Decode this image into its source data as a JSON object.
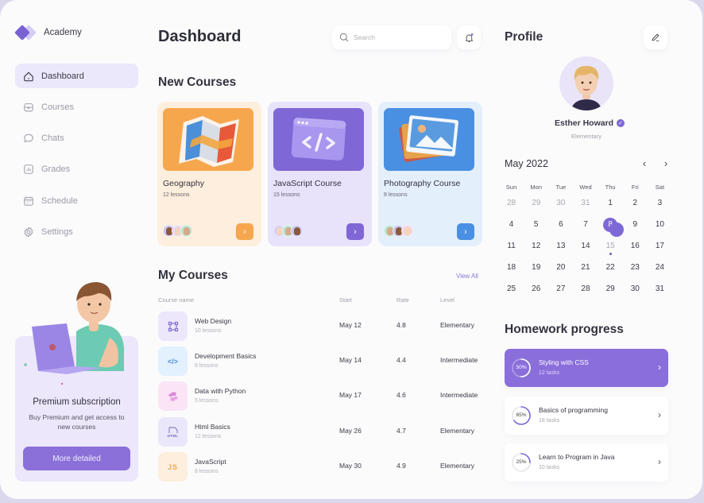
{
  "app": {
    "name": "Academy",
    "brand_color": "#7a62d4"
  },
  "sidebar": {
    "items": [
      {
        "label": "Dashboard",
        "icon": "home-icon",
        "active": true
      },
      {
        "label": "Courses",
        "icon": "briefcase-icon",
        "active": false
      },
      {
        "label": "Chats",
        "icon": "chat-bubble-icon",
        "active": false
      },
      {
        "label": "Grades",
        "icon": "bar-chart-icon",
        "active": false
      },
      {
        "label": "Schedule",
        "icon": "calendar-icon",
        "active": false
      },
      {
        "label": "Settings",
        "icon": "gear-icon",
        "active": false
      }
    ],
    "promo": {
      "title": "Premium subscription",
      "description": "Buy Premium and get access to new courses",
      "button_label": "More detailed"
    }
  },
  "header": {
    "title": "Dashboard",
    "search": {
      "placeholder": "Search",
      "value": ""
    },
    "notifications_icon": "bell-icon"
  },
  "new_courses": {
    "title": "New Courses",
    "cards": [
      {
        "title": "Geography",
        "lessons": "12 lessons",
        "theme": "orange",
        "accent": "#f6a74e"
      },
      {
        "title": "JavaScript Course",
        "lessons": "15 lessons",
        "theme": "purple",
        "accent": "#7f67d6"
      },
      {
        "title": "Photography Course",
        "lessons": "8 lessons",
        "theme": "blue",
        "accent": "#4a90e2"
      }
    ]
  },
  "my_courses": {
    "title": "My Courses",
    "view_all": "View All",
    "columns": [
      "Course name",
      "Start",
      "Rate",
      "Level"
    ],
    "rows": [
      {
        "name": "Web Design",
        "lessons": "10 lessons",
        "start": "May 12",
        "rate": "4.8",
        "level": "Elementary",
        "icon": "vector-frame-icon",
        "icon_text": ""
      },
      {
        "name": "Development Basics",
        "lessons": "8 lessons",
        "start": "May 14",
        "rate": "4.4",
        "level": "Intermediate",
        "icon": "code-icon",
        "icon_text": "</>"
      },
      {
        "name": "Data with Python",
        "lessons": "5 lessons",
        "start": "May 17",
        "rate": "4.6",
        "level": "Intermediate",
        "icon": "python-icon",
        "icon_text": ""
      },
      {
        "name": "Html Basics",
        "lessons": "12 lessons",
        "start": "May 26",
        "rate": "4.7",
        "level": "Elementary",
        "icon": "html-file-icon",
        "icon_text": "HTML"
      },
      {
        "name": "JavaScript",
        "lessons": "8 lessons",
        "start": "May 30",
        "rate": "4.9",
        "level": "Elementary",
        "icon": "js-icon",
        "icon_text": "JS"
      }
    ]
  },
  "profile": {
    "title": "Profile",
    "name": "Esther Howard",
    "level": "Elementary",
    "verified": true
  },
  "calendar": {
    "month_label": "May 2022",
    "weekdays": [
      "Sun",
      "Mon",
      "Tue",
      "Wed",
      "Thu",
      "Fri",
      "Sat"
    ],
    "weeks": [
      [
        "28",
        "29",
        "30",
        "31",
        "1",
        "2",
        "3"
      ],
      [
        "4",
        "5",
        "6",
        "7",
        "8",
        "9",
        "10"
      ],
      [
        "11",
        "12",
        "13",
        "14",
        "15",
        "16",
        "17"
      ],
      [
        "18",
        "19",
        "20",
        "21",
        "22",
        "23",
        "24"
      ],
      [
        "25",
        "26",
        "27",
        "28",
        "29",
        "30",
        "31"
      ]
    ],
    "muted_days_first_week": 4,
    "selected_day": "8",
    "event_days": [
      "8",
      "15"
    ]
  },
  "homework": {
    "title": "Homework progress",
    "items": [
      {
        "name": "Styling with CSS",
        "tasks": "12 tasks",
        "percent_label": "50%",
        "progress": 0.5,
        "active": true
      },
      {
        "name": "Basics of programming",
        "tasks": "18 tasks",
        "percent_label": "65%",
        "progress": 0.65,
        "active": false
      },
      {
        "name": "Learn to Program in Java",
        "tasks": "10 tasks",
        "percent_label": "25%",
        "progress": 0.25,
        "active": false
      }
    ]
  }
}
